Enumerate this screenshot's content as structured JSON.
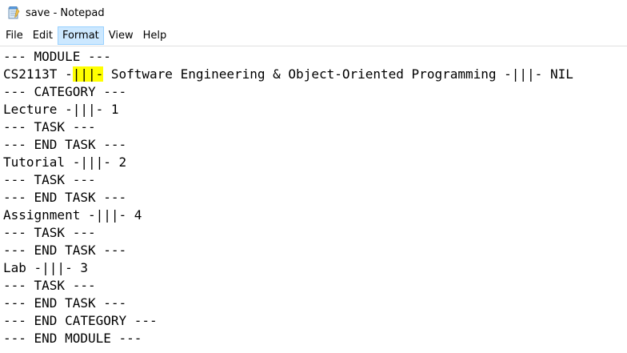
{
  "window": {
    "title": "save - Notepad",
    "icon": "notepad-icon"
  },
  "menu": {
    "items": [
      "File",
      "Edit",
      "Format",
      "View",
      "Help"
    ],
    "active": "Format"
  },
  "editor": {
    "lines": [
      "--- MODULE ---",
      "CS2113T -|||- Software Engineering & Object-Oriented Programming -|||- NIL",
      "--- CATEGORY ---",
      "Lecture -|||- 1",
      "--- TASK ---",
      "--- END TASK ---",
      "Tutorial -|||- 2",
      "--- TASK ---",
      "--- END TASK ---",
      "Assignment -|||- 4",
      "--- TASK ---",
      "--- END TASK ---",
      "Lab -|||- 3",
      "--- TASK ---",
      "--- END TASK ---",
      "--- END CATEGORY ---",
      "--- END MODULE ---"
    ],
    "highlight": {
      "line": 1,
      "text": "|||-",
      "color": "#ffff00"
    }
  }
}
